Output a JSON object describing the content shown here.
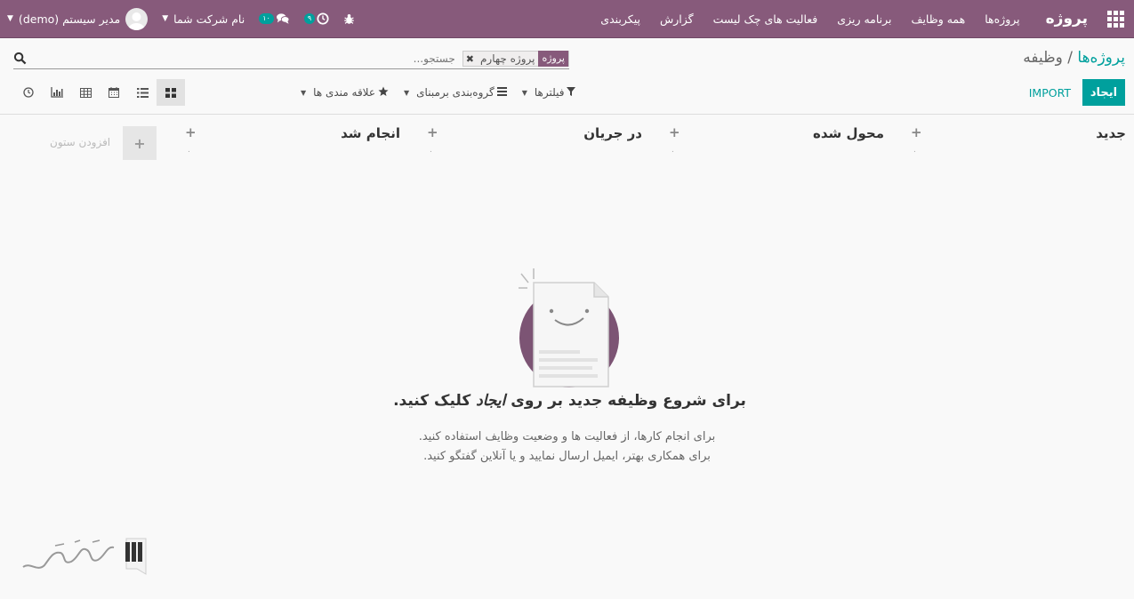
{
  "navbar": {
    "app_name": "پروژه",
    "menu": [
      "پروژه‌ها",
      "همه وظایف",
      "برنامه ریزی",
      "فعالیت های چک لیست",
      "گزارش",
      "پیکربندی"
    ],
    "chat_badge": "۱۰",
    "activity_badge": "۹",
    "company": "نام شرکت شما",
    "user": "مدیر سیستم (demo)",
    "bg_color": "#875a7b"
  },
  "breadcrumb": {
    "parent": "پروژه‌ها",
    "separator": "/",
    "current": "وظیفه"
  },
  "search": {
    "facet_label": "پروژه",
    "facet_value": "پروژه چهارم",
    "placeholder": "جستجو..."
  },
  "buttons": {
    "create": "ایجاد",
    "import": "IMPORT",
    "accent_color": "#00a09d"
  },
  "filters": {
    "filters_label": "فیلترها",
    "groupby_label": "گروه‌بندی برمبنای",
    "favorites_label": "علاقه مندی ها"
  },
  "views": [
    "kanban-view",
    "list-view",
    "calendar-view",
    "pivot-view",
    "graph-view",
    "activity-view"
  ],
  "columns": [
    {
      "title": "جدید",
      "count": "۰"
    },
    {
      "title": "محول شده",
      "count": "۰"
    },
    {
      "title": "در جریان",
      "count": "۰"
    },
    {
      "title": "انجام شد",
      "count": "۰"
    }
  ],
  "add_column": {
    "label": "افزودن ستون",
    "icon": "+"
  },
  "helper": {
    "title_before": "برای شروع وظیفه جدید بر روی ",
    "title_em": "ایجاد",
    "title_after": " کلیک کنید.",
    "line1": "برای انجام کارها، از فعالیت ها و وضعیت وظایف استفاده کنید.",
    "line2": "برای همکاری بهتر، ایمیل ارسال نمایید و یا آنلاین گفتگو کنید."
  }
}
